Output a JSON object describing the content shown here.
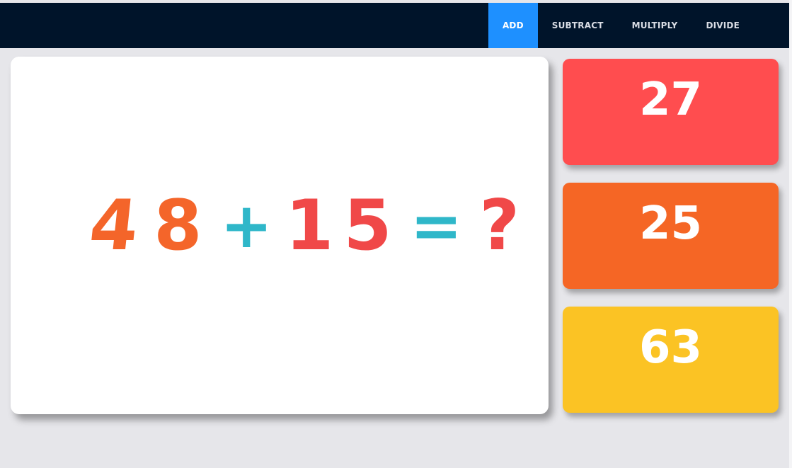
{
  "nav": {
    "items": [
      {
        "label": "ADD",
        "active": true
      },
      {
        "label": "SUBTRACT",
        "active": false
      },
      {
        "label": "MULTIPLY",
        "active": false
      },
      {
        "label": "DIVIDE",
        "active": false
      }
    ]
  },
  "question": {
    "digit1": "4",
    "digit2": "8",
    "operator": "+",
    "digit3": "1",
    "digit4": "5",
    "equals": "=",
    "unknown": "?"
  },
  "answers": [
    "27",
    "25",
    "63"
  ],
  "colors": {
    "topbar": "#00142a",
    "nav_active": "#1e90ff",
    "answer1": "#ff4d4f",
    "answer2": "#f56625",
    "answer3": "#fbc324",
    "operator": "#2fb7c9"
  }
}
